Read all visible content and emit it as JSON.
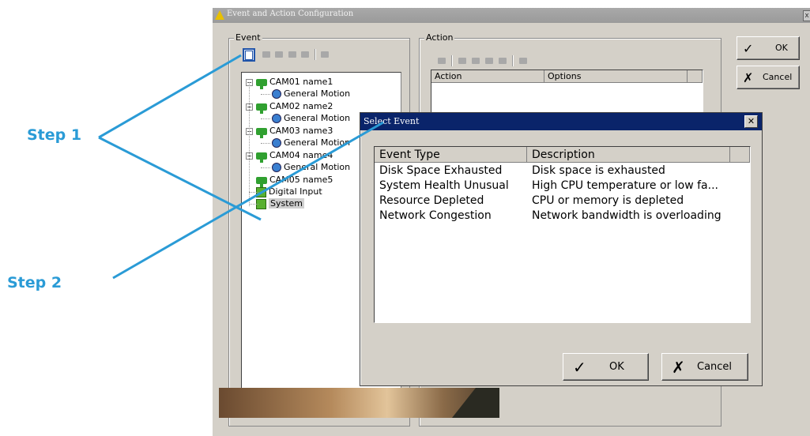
{
  "window": {
    "title": "Event and Action Configuration",
    "close_glyph": "x"
  },
  "event_panel": {
    "label": "Event",
    "tree": [
      {
        "label": "CAM01 name1",
        "type": "camera",
        "expanded": true
      },
      {
        "label": "General Motion",
        "type": "motion"
      },
      {
        "label": "CAM02 name2",
        "type": "camera",
        "expanded": true
      },
      {
        "label": "General Motion",
        "type": "motion"
      },
      {
        "label": "CAM03 name3",
        "type": "camera",
        "expanded": true
      },
      {
        "label": "General Motion",
        "type": "motion"
      },
      {
        "label": "CAM04 name4",
        "type": "camera",
        "expanded": true
      },
      {
        "label": "General Motion",
        "type": "motion"
      },
      {
        "label": "CAM05 name5",
        "type": "camera"
      },
      {
        "label": "Digital Input",
        "type": "digital"
      },
      {
        "label": "System",
        "type": "digital",
        "selected": true
      }
    ],
    "expand_glyph": "−"
  },
  "action_panel": {
    "label": "Action",
    "columns": [
      "Action",
      "Options"
    ]
  },
  "buttons": {
    "ok": "OK",
    "cancel": "Cancel",
    "ok_glyph": "✓",
    "cancel_glyph": "✗"
  },
  "dialog": {
    "title": "Select Event",
    "close_glyph": "✕",
    "columns": [
      "Event Type",
      "Description"
    ],
    "rows": [
      [
        "Disk Space Exhausted",
        "Disk space is exhausted"
      ],
      [
        "System Health Unusual",
        "High CPU temperature or low fa..."
      ],
      [
        "Resource Depleted",
        "CPU or memory is depleted"
      ],
      [
        "Network Congestion",
        "Network bandwidth is overloading"
      ]
    ],
    "ok": "OK",
    "cancel": "Cancel"
  },
  "annotations": {
    "step1": "Step 1",
    "step2": "Step 2",
    "color": "#2a9bd6"
  }
}
